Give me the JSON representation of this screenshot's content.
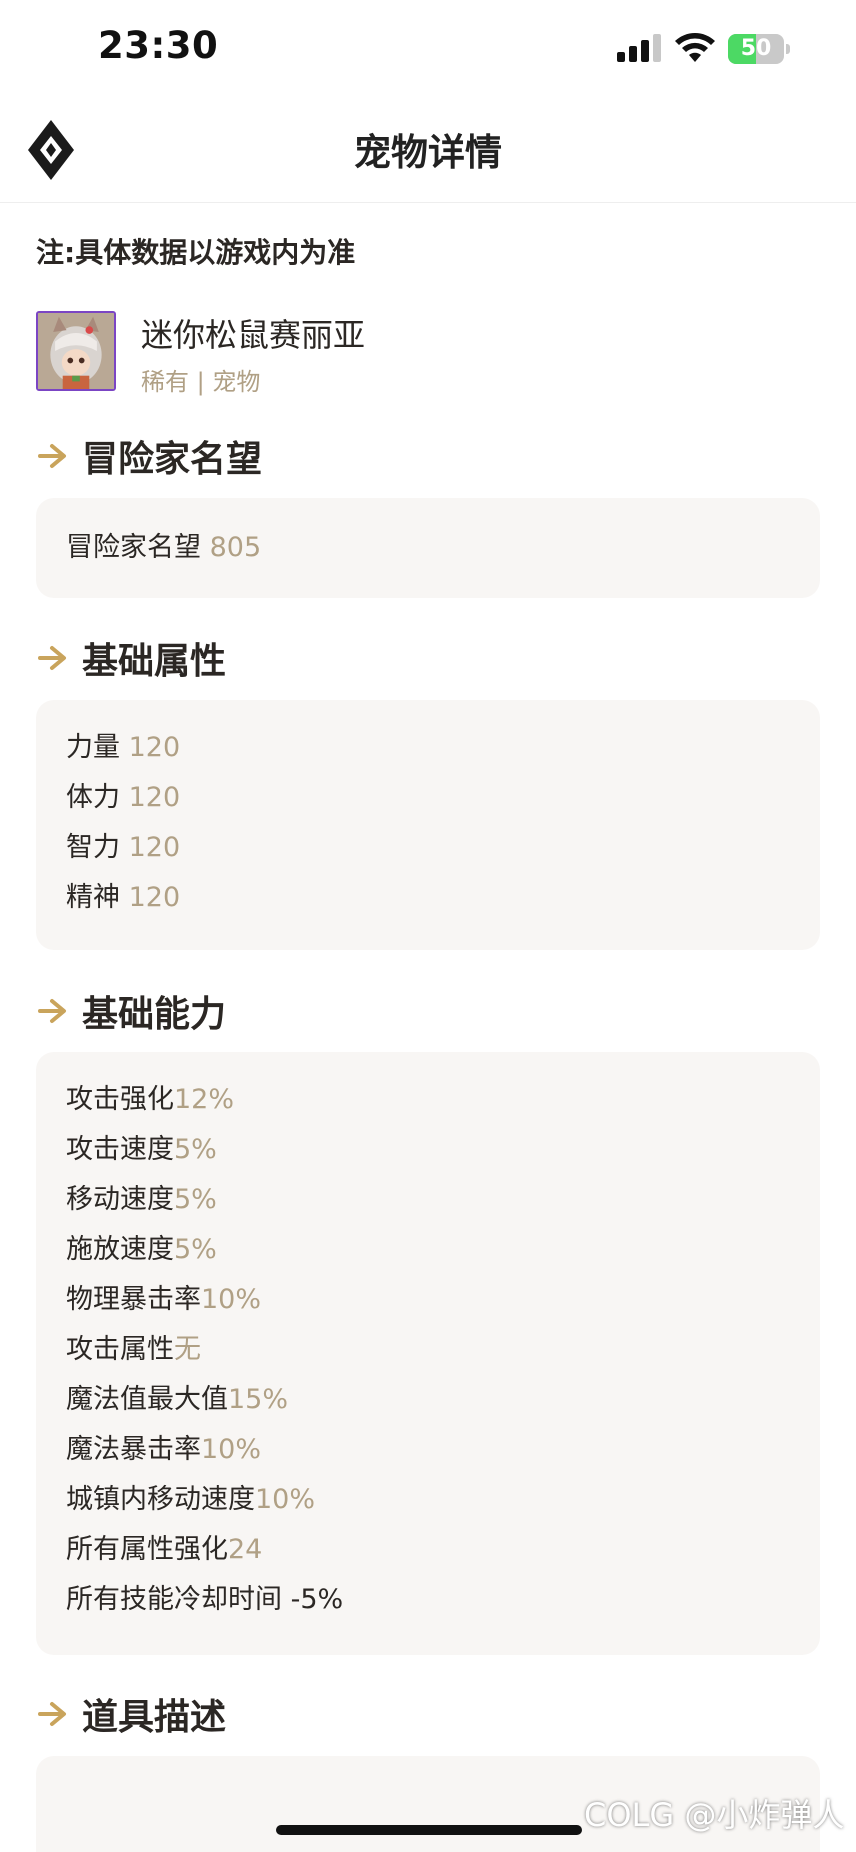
{
  "status_bar": {
    "time": "23:30",
    "battery_level": "50",
    "battery_fraction": 0.5,
    "battery_color": "#4cd964"
  },
  "nav": {
    "title": "宠物详情",
    "logo_icon": "diamond-logo-icon"
  },
  "note": "注:具体数据以游戏内为准",
  "item": {
    "name": "迷你松鼠赛丽亚",
    "tags": "稀有  | 宠物",
    "icon": "pet-portrait-icon",
    "frame_color": "#7b45c4"
  },
  "sections": {
    "reputation": {
      "title": "冒险家名望",
      "rows": [
        {
          "label": "冒险家名望 ",
          "value": "805"
        }
      ]
    },
    "base_attributes": {
      "title": "基础属性",
      "rows": [
        {
          "label": "力量 ",
          "value": "120"
        },
        {
          "label": "体力 ",
          "value": "120"
        },
        {
          "label": "智力 ",
          "value": "120"
        },
        {
          "label": "精神 ",
          "value": "120"
        }
      ]
    },
    "base_abilities": {
      "title": "基础能力",
      "rows": [
        {
          "label": "攻击强化",
          "value": "12%"
        },
        {
          "label": "攻击速度",
          "value": "5%"
        },
        {
          "label": "移动速度",
          "value": "5%"
        },
        {
          "label": "施放速度",
          "value": "5%"
        },
        {
          "label": "物理暴击率",
          "value": "10%"
        },
        {
          "label": "攻击属性",
          "value": "无"
        },
        {
          "label": "魔法值最大值",
          "value": "15%"
        },
        {
          "label": "魔法暴击率",
          "value": "10%"
        },
        {
          "label": "城镇内移动速度",
          "value": "10%"
        },
        {
          "label": "所有属性强化",
          "value": "24"
        },
        {
          "label": "所有技能冷却时间 -5%",
          "value": ""
        }
      ]
    },
    "description": {
      "title": "道具描述"
    }
  },
  "watermark": "COLG @小炸弹人",
  "accent_color": "#c9a45c"
}
